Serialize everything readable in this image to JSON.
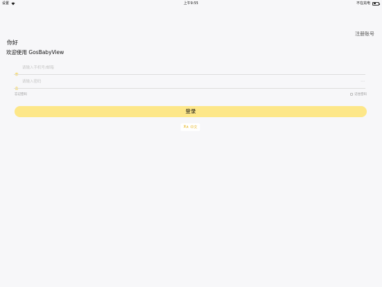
{
  "status_bar": {
    "carrier": "设置",
    "time": "上午9:55",
    "charging": "不在充电"
  },
  "header": {
    "register_label": "注册账号"
  },
  "intro": {
    "greeting": "你好",
    "welcome": "欢迎使用 GosBabyView"
  },
  "form": {
    "account_placeholder": "请输入手机号/邮箱",
    "password_placeholder": "请输入密码",
    "forgot_label": "忘记密码",
    "remember_label": "记住密码",
    "login_label": "登录"
  },
  "language": {
    "label": "中文"
  },
  "colors": {
    "accent": "#fde789",
    "icon": "#f5d65a",
    "language_text": "#e7b92c"
  },
  "icons": [
    "wifi-icon",
    "battery-icon",
    "phone-icon",
    "lock-icon",
    "eye-icon",
    "translate-icon"
  ]
}
